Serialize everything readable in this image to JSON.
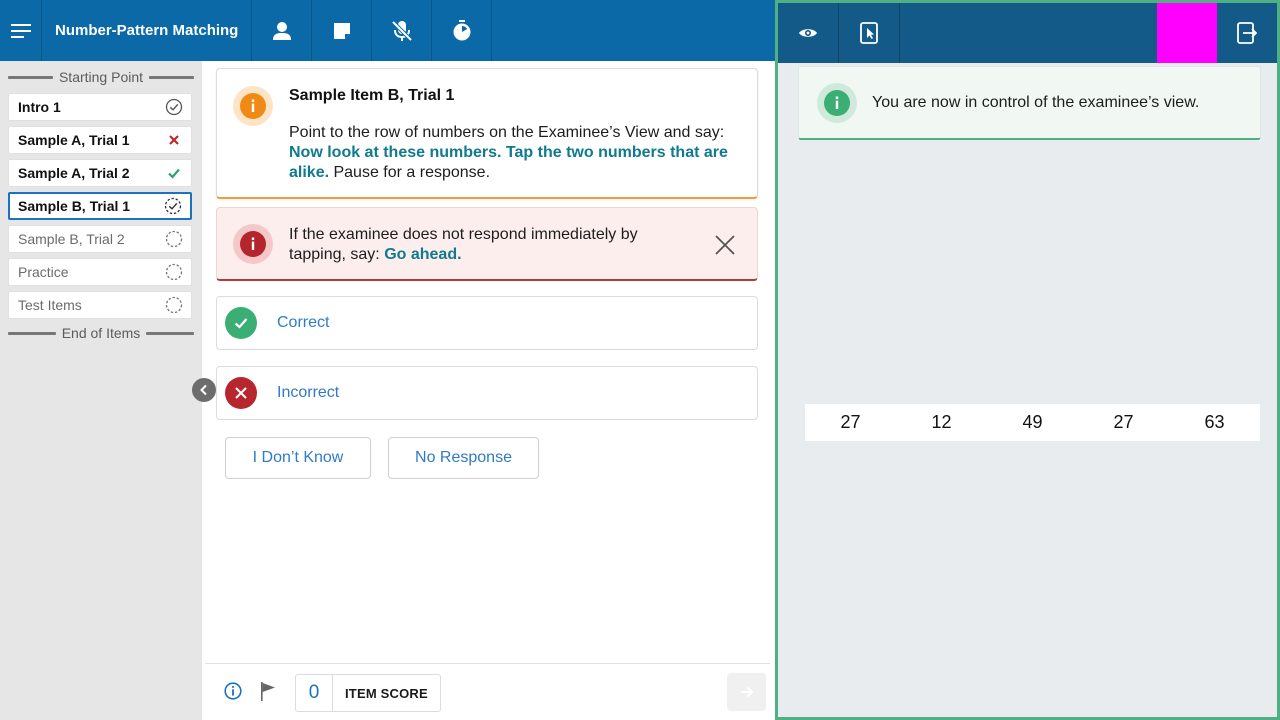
{
  "header": {
    "title": "Number-Pattern Matching",
    "icons": [
      "menu-icon",
      "examinee-icon",
      "notes-icon",
      "microphone-off-icon",
      "timer-icon"
    ]
  },
  "sidebar": {
    "start_label": "Starting Point",
    "end_label": "End of Items",
    "items": [
      {
        "label": "Intro 1",
        "status": "complete"
      },
      {
        "label": "Sample A, Trial 1",
        "status": "incorrect"
      },
      {
        "label": "Sample A, Trial 2",
        "status": "correct"
      },
      {
        "label": "Sample B, Trial 1",
        "status": "in-progress"
      },
      {
        "label": "Sample B, Trial 2",
        "status": "not-started"
      },
      {
        "label": "Practice",
        "status": "not-started"
      },
      {
        "label": "Test Items",
        "status": "not-started"
      }
    ]
  },
  "instruction": {
    "title": "Sample Item B, Trial 1",
    "lead": "Point to the row of numbers on the Examinee’s View and say:",
    "say": "Now look at these numbers. Tap the two numbers that are alike.",
    "tail": "Pause for a response."
  },
  "alert": {
    "lead": "If the examinee does not respond immediately by tapping, say:",
    "say": "Go ahead."
  },
  "responses": {
    "correct": "Correct",
    "incorrect": "Incorrect",
    "dont_know": "I Don’t Know",
    "no_response": "No Response"
  },
  "footer": {
    "score": "0",
    "score_label": "ITEM SCORE"
  },
  "examinee_view": {
    "info_text": "You are now in control of the examinee’s view.",
    "numbers": [
      "27",
      "12",
      "49",
      "27",
      "63"
    ],
    "icons": [
      "eye-icon",
      "tablet-touch-icon",
      "exit-tablet-icon"
    ]
  },
  "colors": {
    "header_blue": "#0b69a8",
    "examinee_header": "#135a88",
    "accent_green": "#4eb083",
    "say_teal": "#107a8e",
    "link_blue": "#2f7bc6",
    "warning_orange": "#f08a16",
    "error_red": "#b3262d",
    "marker_magenta": "#ff00ff"
  }
}
